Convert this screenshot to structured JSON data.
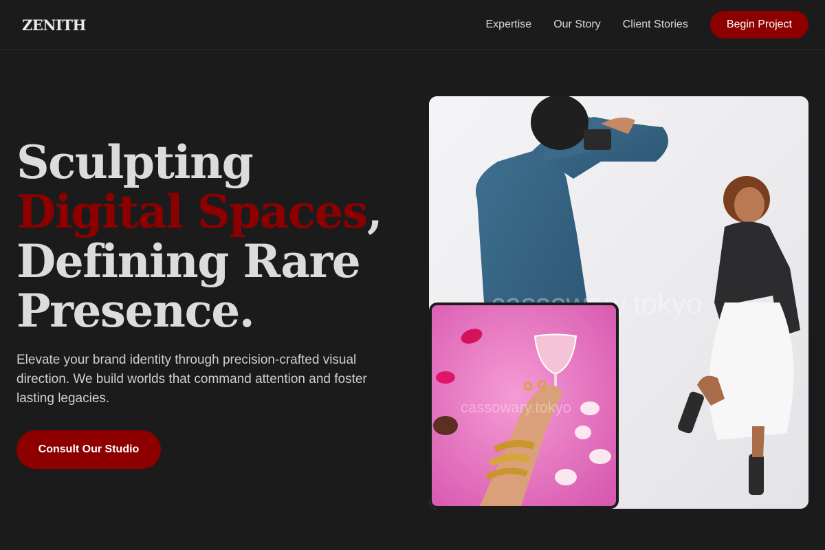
{
  "brand": {
    "logo": "ZENITH"
  },
  "nav": {
    "links": [
      "Expertise",
      "Our Story",
      "Client Stories"
    ],
    "cta": "Begin Project"
  },
  "hero": {
    "title_line1": "Sculpting",
    "title_accent": "Digital Spaces",
    "title_comma": ",",
    "title_line3": "Defining Rare",
    "title_line4": "Presence.",
    "subtitle": "Elevate your brand identity through precision-crafted visual direction. We build worlds that command attention and foster lasting legacies.",
    "cta": "Consult Our Studio"
  },
  "images": {
    "watermark": "cassowary.tokyo"
  },
  "colors": {
    "background": "#1b1b1c",
    "accent": "#8e0000",
    "text": "#dcdcdc"
  }
}
